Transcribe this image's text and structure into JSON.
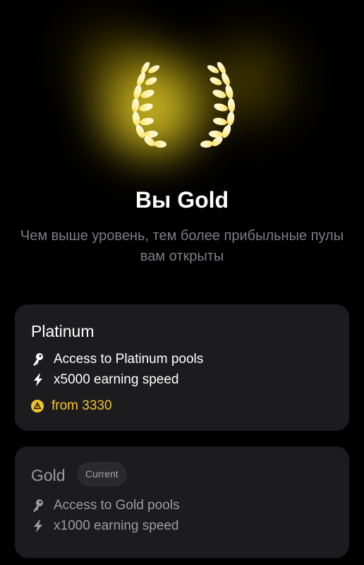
{
  "colors": {
    "background": "#000000",
    "card": "#1c1c1e",
    "gold_accent": "#f4c430",
    "muted_text": "#7e7e83"
  },
  "hero": {
    "icon": "laurel-wreath-icon",
    "title": "Вы Gold",
    "subtitle": "Чем выше уровень, тем более прибыльные пулы вам открыты"
  },
  "tiers": [
    {
      "name": "Platinum",
      "features": [
        {
          "icon": "key-icon",
          "text": "Access to Platinum pools"
        },
        {
          "icon": "lightning-icon",
          "text": "x5000 earning speed"
        }
      ],
      "price": {
        "icon": "coin-icon",
        "text": "from 3330"
      }
    },
    {
      "name": "Gold",
      "badge": "Current",
      "features": [
        {
          "icon": "key-icon",
          "text": "Access to Gold pools"
        },
        {
          "icon": "lightning-icon",
          "text": "x1000 earning speed"
        }
      ]
    }
  ]
}
